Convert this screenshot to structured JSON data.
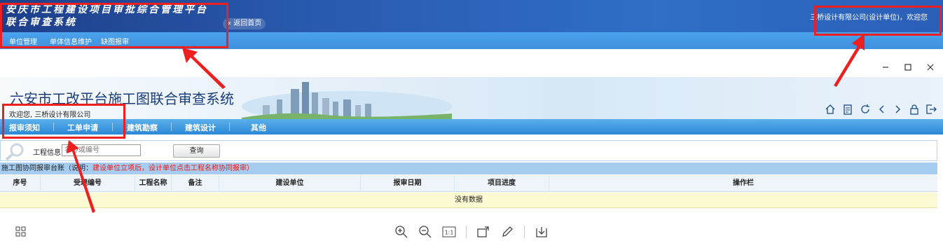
{
  "outer": {
    "title_line1": "安庆市工程建设项目审批综合管理平台",
    "title_line2": "联合审查系统",
    "back_home": "返回首页",
    "welcome": "三桥设计有限公司(设计单位)，欢迎您",
    "nav": [
      "单位管理",
      "单体信息维护",
      "缺图报审"
    ]
  },
  "window_controls": [
    "minimize-icon",
    "maximize-icon",
    "close-icon"
  ],
  "inner": {
    "title": "六安市工改平台施工图联合审查系统",
    "welcome": "欢迎您, 三桥设计有限公司",
    "toolbar_icons": [
      "home-icon",
      "clipboard-icon",
      "refresh-icon",
      "back-icon",
      "forward-icon",
      "lock-icon",
      "logout-icon"
    ],
    "nav": [
      "报审须知",
      "工单申请",
      "建筑勘察",
      "建筑设计",
      "其他"
    ]
  },
  "search": {
    "label": "工程信息",
    "placeholder": "名称或编号",
    "button": "查询"
  },
  "table": {
    "caption": "施工图协同报审台账（说明：",
    "caption_note": "建设单位立项后，设计单位点击工程名称协同报审）",
    "columns": [
      "序号",
      "受理编号",
      "工程名称",
      "备注",
      "建设单位",
      "报审日期",
      "项目进度",
      "操作栏"
    ],
    "empty": "没有数据"
  },
  "viewer_toolbar": [
    "grid-icon",
    "zoom-in-icon",
    "zoom-out-icon",
    "actual-size-icon",
    "rotate-icon",
    "edit-icon",
    "download-icon"
  ],
  "colors": {
    "annotation": "#ee1f1f",
    "header": "#2a5bb0",
    "nav": "#3f8fdc"
  }
}
